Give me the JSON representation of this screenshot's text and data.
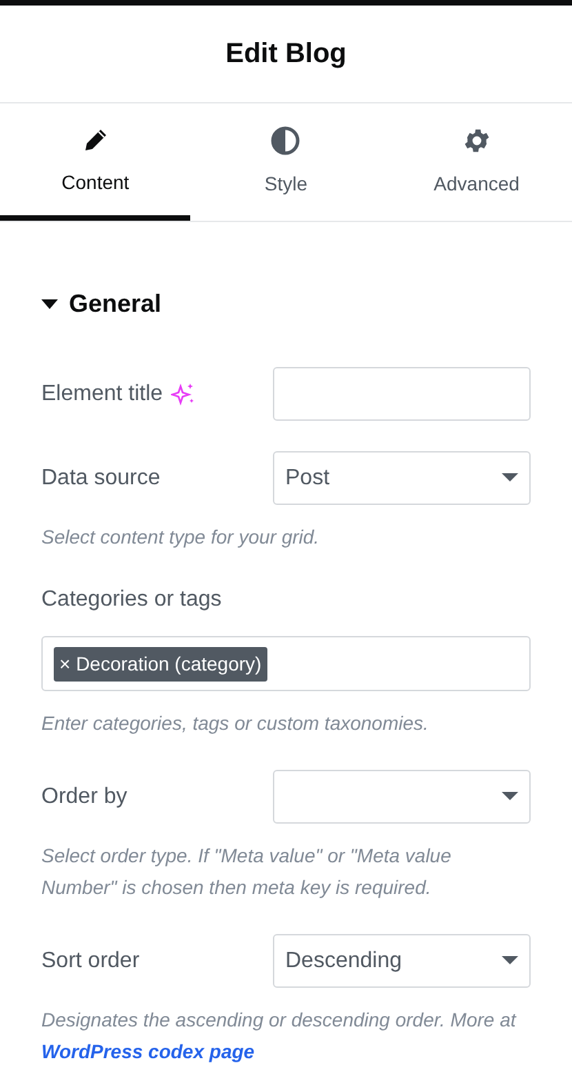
{
  "panel": {
    "title": "Edit Blog"
  },
  "tabs": [
    {
      "label": "Content",
      "kind": "pencil",
      "selected": true
    },
    {
      "label": "Style",
      "kind": "contrast",
      "selected": false
    },
    {
      "label": "Advanced",
      "kind": "gear",
      "selected": false
    }
  ],
  "section": {
    "title": "General",
    "expanded": true
  },
  "fields": [
    {
      "kind": "text",
      "label": "Element title",
      "ai_icon": true
    },
    {
      "kind": "select",
      "label": "Data source",
      "value": "Post",
      "hint": "Select content type for your grid."
    },
    {
      "kind": "tags",
      "label": "Categories or tags",
      "tags": [
        "Decoration (category)"
      ],
      "remove_symbol": "×",
      "hint": "Enter categories, tags or custom taxonomies."
    },
    {
      "kind": "select",
      "label": "Order by",
      "hint": "Select order type. If \"Meta value\" or \"Meta value Number\" is chosen then meta key is required."
    },
    {
      "kind": "select",
      "label": "Sort order",
      "value": "Descending",
      "hint": "Designates the ascending or descending order. More at",
      "hint_link": "WordPress codex page"
    }
  ]
}
